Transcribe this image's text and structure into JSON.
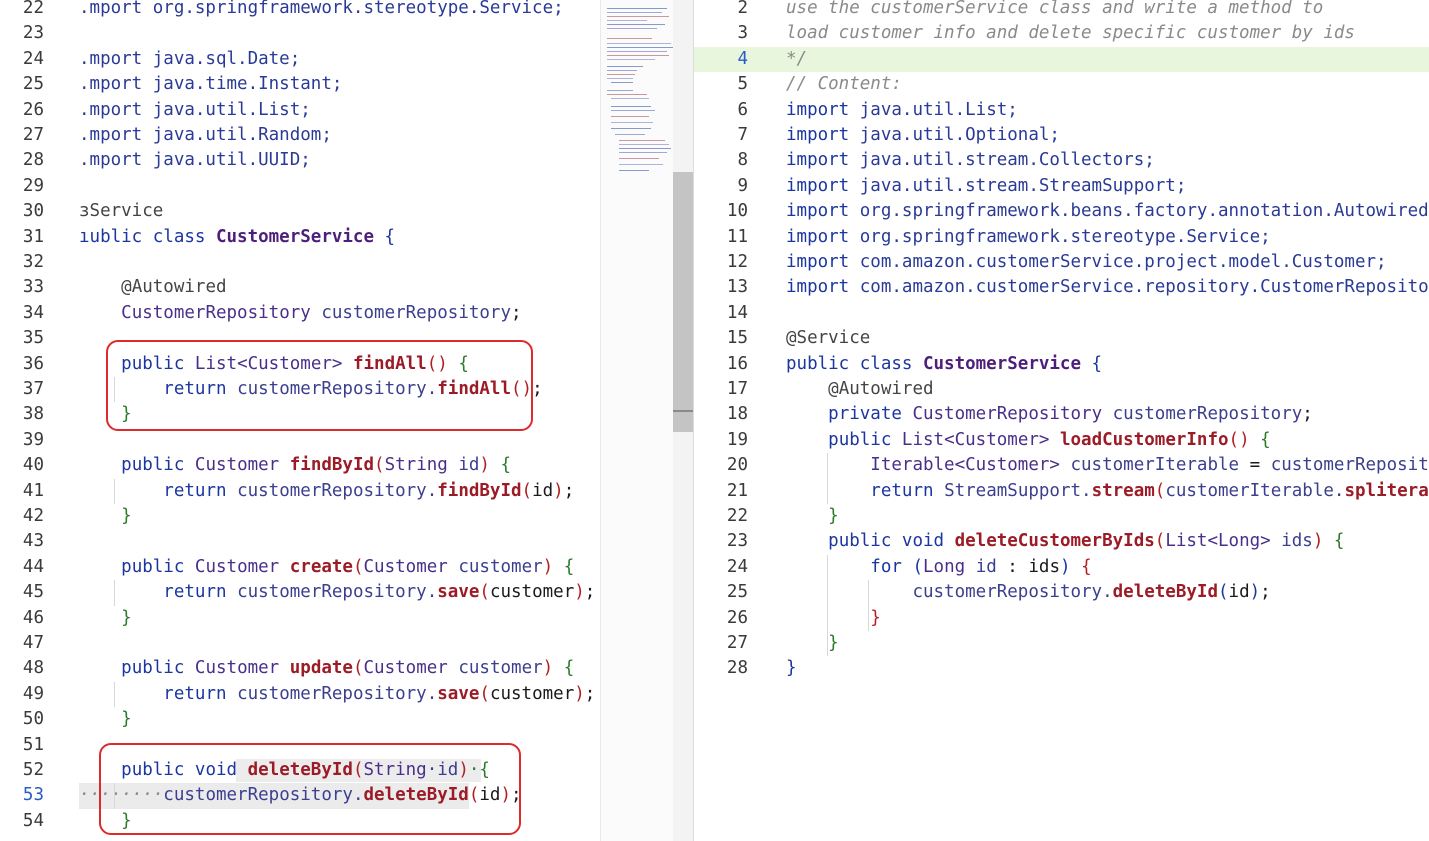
{
  "left_editor": {
    "lines": [
      {
        "num": "22",
        "tokens": [
          [
            "pk",
            ".mport org.springframework.stereotype.Service;"
          ]
        ]
      },
      {
        "num": "23",
        "tokens": []
      },
      {
        "num": "24",
        "tokens": [
          [
            "pk",
            ".mport java.sql.Date;"
          ]
        ]
      },
      {
        "num": "25",
        "tokens": [
          [
            "pk",
            ".mport java.time.Instant;"
          ]
        ]
      },
      {
        "num": "26",
        "tokens": [
          [
            "pk",
            ".mport java.util.List;"
          ]
        ]
      },
      {
        "num": "27",
        "tokens": [
          [
            "pk",
            ".mport java.util.Random;"
          ]
        ]
      },
      {
        "num": "28",
        "tokens": [
          [
            "pk",
            ".mport java.util.UUID;"
          ]
        ]
      },
      {
        "num": "29",
        "tokens": []
      },
      {
        "num": "30",
        "tokens": [
          [
            "an",
            "ɜService"
          ]
        ]
      },
      {
        "num": "31",
        "tokens": [
          [
            "kw",
            "ıublic class "
          ],
          [
            "cls",
            "CustomerService"
          ],
          [
            "p2",
            " {"
          ]
        ]
      },
      {
        "num": "32",
        "tokens": []
      },
      {
        "num": "33",
        "tokens": [
          [
            "pl",
            "    "
          ],
          [
            "an",
            "@Autowired"
          ]
        ]
      },
      {
        "num": "34",
        "tokens": [
          [
            "pl",
            "    "
          ],
          [
            "ty",
            "CustomerRepository"
          ],
          [
            "id",
            " customerRepository"
          ],
          [
            "pl",
            ";"
          ]
        ]
      },
      {
        "num": "35",
        "tokens": []
      },
      {
        "num": "36",
        "tokens": [
          [
            "pl",
            "    "
          ],
          [
            "kw",
            "public "
          ],
          [
            "ty",
            "List<Customer> "
          ],
          [
            "fn",
            "findAll"
          ],
          [
            "p3",
            "()"
          ],
          [
            "p1",
            " {"
          ]
        ]
      },
      {
        "num": "37",
        "tokens": [
          [
            "pl",
            "        "
          ],
          [
            "kw",
            "return "
          ],
          [
            "id",
            "customerRepository."
          ],
          [
            "fn",
            "findAll"
          ],
          [
            "p3",
            "()"
          ],
          [
            "pl",
            ";"
          ]
        ]
      },
      {
        "num": "38",
        "tokens": [
          [
            "pl",
            "    "
          ],
          [
            "p1",
            "}"
          ]
        ]
      },
      {
        "num": "39",
        "tokens": []
      },
      {
        "num": "40",
        "tokens": [
          [
            "pl",
            "    "
          ],
          [
            "kw",
            "public "
          ],
          [
            "ty",
            "Customer "
          ],
          [
            "fn",
            "findById"
          ],
          [
            "p3",
            "("
          ],
          [
            "ty",
            "String"
          ],
          [
            "id",
            " id"
          ],
          [
            "p3",
            ")"
          ],
          [
            "p1",
            " {"
          ]
        ]
      },
      {
        "num": "41",
        "tokens": [
          [
            "pl",
            "        "
          ],
          [
            "kw",
            "return "
          ],
          [
            "id",
            "customerRepository."
          ],
          [
            "fn",
            "findById"
          ],
          [
            "p3",
            "("
          ],
          [
            "pl",
            "id"
          ],
          [
            "p3",
            ")"
          ],
          [
            "pl",
            ";"
          ]
        ]
      },
      {
        "num": "42",
        "tokens": [
          [
            "pl",
            "    "
          ],
          [
            "p1",
            "}"
          ]
        ]
      },
      {
        "num": "43",
        "tokens": []
      },
      {
        "num": "44",
        "tokens": [
          [
            "pl",
            "    "
          ],
          [
            "kw",
            "public "
          ],
          [
            "ty",
            "Customer "
          ],
          [
            "fn",
            "create"
          ],
          [
            "p3",
            "("
          ],
          [
            "ty",
            "Customer"
          ],
          [
            "id",
            " customer"
          ],
          [
            "p3",
            ")"
          ],
          [
            "p1",
            " {"
          ]
        ]
      },
      {
        "num": "45",
        "tokens": [
          [
            "pl",
            "        "
          ],
          [
            "kw",
            "return "
          ],
          [
            "id",
            "customerRepository."
          ],
          [
            "fn",
            "save"
          ],
          [
            "p3",
            "("
          ],
          [
            "pl",
            "customer"
          ],
          [
            "p3",
            ")"
          ],
          [
            "pl",
            ";"
          ]
        ]
      },
      {
        "num": "46",
        "tokens": [
          [
            "pl",
            "    "
          ],
          [
            "p1",
            "}"
          ]
        ]
      },
      {
        "num": "47",
        "tokens": []
      },
      {
        "num": "48",
        "tokens": [
          [
            "pl",
            "    "
          ],
          [
            "kw",
            "public "
          ],
          [
            "ty",
            "Customer "
          ],
          [
            "fn",
            "update"
          ],
          [
            "p3",
            "("
          ],
          [
            "ty",
            "Customer"
          ],
          [
            "id",
            " customer"
          ],
          [
            "p3",
            ")"
          ],
          [
            "p1",
            " {"
          ]
        ]
      },
      {
        "num": "49",
        "tokens": [
          [
            "pl",
            "        "
          ],
          [
            "kw",
            "return "
          ],
          [
            "id",
            "customerRepository."
          ],
          [
            "fn",
            "save"
          ],
          [
            "p3",
            "("
          ],
          [
            "pl",
            "customer"
          ],
          [
            "p3",
            ")"
          ],
          [
            "pl",
            ";"
          ]
        ]
      },
      {
        "num": "50",
        "tokens": [
          [
            "pl",
            "    "
          ],
          [
            "p1",
            "}"
          ]
        ]
      },
      {
        "num": "51",
        "tokens": []
      },
      {
        "num": "52",
        "tokens": [
          [
            "pl",
            "    "
          ],
          [
            "kw",
            "public void "
          ],
          [
            "fn",
            "deleteById"
          ],
          [
            "p3",
            "("
          ],
          [
            "ty",
            "String"
          ],
          [
            "id",
            "·id"
          ],
          [
            "p3",
            ")"
          ],
          [
            "p1",
            "·{"
          ]
        ]
      },
      {
        "num": "53",
        "active": true,
        "tokens": [
          [
            "cm",
            "········"
          ],
          [
            "id",
            "customerRepository."
          ],
          [
            "fn",
            "deleteById"
          ],
          [
            "p3",
            "("
          ],
          [
            "pl",
            "id"
          ],
          [
            "p3",
            ")"
          ],
          [
            "pl",
            ";"
          ]
        ]
      },
      {
        "num": "54",
        "tokens": [
          [
            "pl",
            "    "
          ],
          [
            "p1",
            "}"
          ]
        ]
      }
    ]
  },
  "right_editor": {
    "lines": [
      {
        "num": "2",
        "tokens": [
          [
            "cm",
            "use the customerService class and write a method to"
          ]
        ]
      },
      {
        "num": "3",
        "tokens": [
          [
            "cm",
            "load customer info and delete specific customer by ids"
          ]
        ]
      },
      {
        "num": "4",
        "active": true,
        "tokens": [
          [
            "cm",
            "*/"
          ]
        ]
      },
      {
        "num": "5",
        "tokens": [
          [
            "cm",
            "// Content:"
          ]
        ]
      },
      {
        "num": "6",
        "tokens": [
          [
            "kw",
            "import "
          ],
          [
            "pk",
            "java.util.List;"
          ]
        ]
      },
      {
        "num": "7",
        "tokens": [
          [
            "kw",
            "import "
          ],
          [
            "pk",
            "java.util.Optional;"
          ]
        ]
      },
      {
        "num": "8",
        "tokens": [
          [
            "kw",
            "import "
          ],
          [
            "pk",
            "java.util.stream.Collectors;"
          ]
        ]
      },
      {
        "num": "9",
        "tokens": [
          [
            "kw",
            "import "
          ],
          [
            "pk",
            "java.util.stream.StreamSupport;"
          ]
        ]
      },
      {
        "num": "10",
        "tokens": [
          [
            "kw",
            "import "
          ],
          [
            "pk",
            "org.springframework.beans.factory.annotation.Autowired;"
          ]
        ]
      },
      {
        "num": "11",
        "tokens": [
          [
            "kw",
            "import "
          ],
          [
            "pk",
            "org.springframework.stereotype.Service;"
          ]
        ]
      },
      {
        "num": "12",
        "tokens": [
          [
            "kw",
            "import "
          ],
          [
            "pk",
            "com.amazon.customerService.project.model.Customer;"
          ]
        ]
      },
      {
        "num": "13",
        "tokens": [
          [
            "kw",
            "import "
          ],
          [
            "pk",
            "com.amazon.customerService.repository.CustomerRepository"
          ]
        ]
      },
      {
        "num": "14",
        "tokens": []
      },
      {
        "num": "15",
        "tokens": [
          [
            "an",
            "@Service"
          ]
        ]
      },
      {
        "num": "16",
        "tokens": [
          [
            "kw",
            "public class "
          ],
          [
            "cls",
            "CustomerService"
          ],
          [
            "p2",
            " {"
          ]
        ]
      },
      {
        "num": "17",
        "tokens": [
          [
            "pl",
            "    "
          ],
          [
            "an",
            "@Autowired"
          ]
        ]
      },
      {
        "num": "18",
        "tokens": [
          [
            "pl",
            "    "
          ],
          [
            "kw",
            "private "
          ],
          [
            "ty",
            "CustomerRepository"
          ],
          [
            "id",
            " customerRepository"
          ],
          [
            "pl",
            ";"
          ]
        ]
      },
      {
        "num": "19",
        "tokens": [
          [
            "pl",
            "    "
          ],
          [
            "kw",
            "public "
          ],
          [
            "ty",
            "List<Customer> "
          ],
          [
            "fn",
            "loadCustomerInfo"
          ],
          [
            "p3",
            "()"
          ],
          [
            "p1",
            " {"
          ]
        ]
      },
      {
        "num": "20",
        "tokens": [
          [
            "pl",
            "        "
          ],
          [
            "ty",
            "Iterable<Customer>"
          ],
          [
            "id",
            " customerIterable"
          ],
          [
            "pl",
            " = "
          ],
          [
            "id",
            "customerRepositor"
          ]
        ]
      },
      {
        "num": "21",
        "tokens": [
          [
            "pl",
            "        "
          ],
          [
            "kw",
            "return "
          ],
          [
            "id",
            "StreamSupport."
          ],
          [
            "fn",
            "stream"
          ],
          [
            "p3",
            "("
          ],
          [
            "id",
            "customerIterable."
          ],
          [
            "fn",
            "spliterato"
          ]
        ]
      },
      {
        "num": "22",
        "tokens": [
          [
            "pl",
            "    "
          ],
          [
            "p1",
            "}"
          ]
        ]
      },
      {
        "num": "23",
        "tokens": [
          [
            "pl",
            "    "
          ],
          [
            "kw",
            "public void "
          ],
          [
            "fn",
            "deleteCustomerByIds"
          ],
          [
            "p3",
            "("
          ],
          [
            "ty",
            "List<Long>"
          ],
          [
            "id",
            " ids"
          ],
          [
            "p3",
            ")"
          ],
          [
            "p1",
            " {"
          ]
        ]
      },
      {
        "num": "24",
        "tokens": [
          [
            "pl",
            "        "
          ],
          [
            "kw",
            "for "
          ],
          [
            "p2",
            "("
          ],
          [
            "ty",
            "Long"
          ],
          [
            "id",
            " id"
          ],
          [
            "pl",
            " : "
          ],
          [
            "pl",
            "ids"
          ],
          [
            "p2",
            ")"
          ],
          [
            "p3",
            " {"
          ]
        ]
      },
      {
        "num": "25",
        "tokens": [
          [
            "pl",
            "            "
          ],
          [
            "id",
            "customerRepository."
          ],
          [
            "fn",
            "deleteById"
          ],
          [
            "p2",
            "("
          ],
          [
            "pl",
            "id"
          ],
          [
            "p2",
            ")"
          ],
          [
            "pl",
            ";"
          ]
        ]
      },
      {
        "num": "26",
        "tokens": [
          [
            "pl",
            "        "
          ],
          [
            "p3",
            "}"
          ]
        ]
      },
      {
        "num": "27",
        "tokens": [
          [
            "pl",
            "    "
          ],
          [
            "p1",
            "}"
          ]
        ]
      },
      {
        "num": "28",
        "tokens": [
          [
            "p2",
            "}"
          ]
        ]
      }
    ]
  },
  "colors": {
    "highlight_box": "#dd2a2a",
    "active_line_bg": "#e8f6dd",
    "keyword": "#1b36a0",
    "method": "#9b1c26",
    "class_name": "#4d1f7a"
  }
}
